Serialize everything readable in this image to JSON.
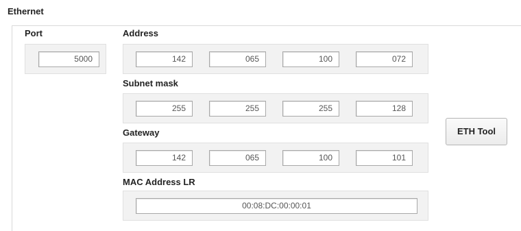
{
  "section": {
    "title": "Ethernet"
  },
  "port": {
    "label": "Port",
    "value": "5000"
  },
  "address": {
    "label": "Address",
    "octets": [
      "142",
      "065",
      "100",
      "072"
    ]
  },
  "subnet": {
    "label": "Subnet mask",
    "octets": [
      "255",
      "255",
      "255",
      "128"
    ]
  },
  "gateway": {
    "label": "Gateway",
    "octets": [
      "142",
      "065",
      "100",
      "101"
    ]
  },
  "mac": {
    "label": "MAC Address LR",
    "value": "00:08:DC:00:00:01"
  },
  "eth_tool": {
    "label": "ETH Tool"
  }
}
